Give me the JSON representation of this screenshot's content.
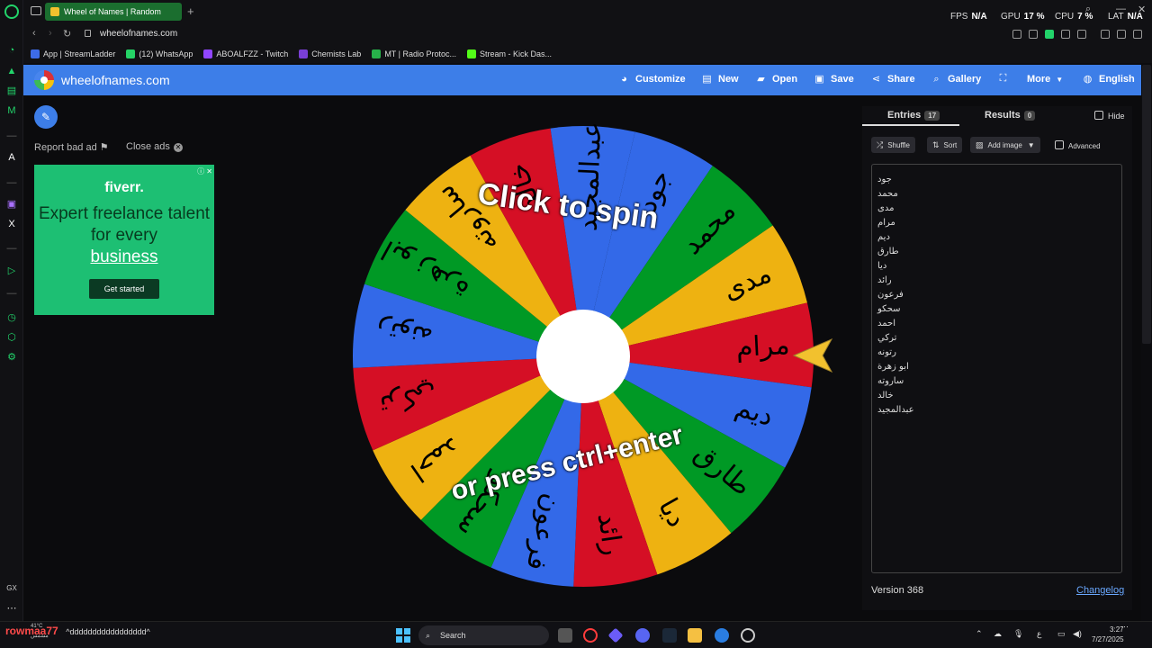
{
  "browser": {
    "tab_title": "Wheel of Names | Random",
    "url": "wheelofnames.com",
    "hud": {
      "fps_label": "FPS",
      "fps_value": "N/A",
      "gpu_label": "GPU",
      "gpu_value": "17 %",
      "cpu_label": "CPU",
      "cpu_value": "7 %",
      "lat_label": "LAT",
      "lat_value": "N/A"
    },
    "bookmarks": [
      {
        "label": "App | StreamLadder",
        "color": "#3d6be8"
      },
      {
        "label": "(12) WhatsApp",
        "color": "#25d366"
      },
      {
        "label": "ABOALFZZ - Twitch",
        "color": "#9146ff"
      },
      {
        "label": "Chemists Lab",
        "color": "#7a3fd6"
      },
      {
        "label": "MT | Radio Protoc...",
        "color": "#27b24a"
      },
      {
        "label": "Stream - Kick Das...",
        "color": "#53fc18"
      }
    ]
  },
  "site": {
    "name": "wheelofnames.com",
    "menu": {
      "customize": "Customize",
      "new": "New",
      "open": "Open",
      "save": "Save",
      "share": "Share",
      "gallery": "Gallery",
      "more": "More",
      "language": "English"
    }
  },
  "ads": {
    "report": "Report bad ad",
    "close": "Close ads",
    "brand": "fiverr.",
    "headline": "Expert freelance talent for every",
    "headline_link": "business",
    "cta": "Get started"
  },
  "wheel": {
    "cta_top": "Click to spin",
    "cta_bottom": "or press ctrl+enter",
    "colors": [
      "#3369e8",
      "#009925",
      "#eeb211",
      "#d50f25"
    ]
  },
  "panel": {
    "tab_entries": "Entries",
    "entries_count": "17",
    "tab_results": "Results",
    "results_count": "0",
    "hide": "Hide",
    "shuffle": "Shuffle",
    "sort": "Sort",
    "add_image": "Add image",
    "advanced": "Advanced",
    "entries": [
      "جود",
      "محمد",
      "مدى",
      "مرام",
      "ديم",
      "طارق",
      "ديا",
      "رائد",
      "فرعون",
      "سحكو",
      "احمد",
      "تركي",
      "رتونه",
      "ابو زهرة",
      "ساروته",
      "خالد",
      "عبدالمجيد"
    ],
    "version": "Version 368",
    "changelog": "Changelog"
  },
  "taskbar": {
    "user": "rowmaa77",
    "status_text": "^ddddddddddddddddd^",
    "temp": "41°C",
    "temp_label": "مشمس",
    "search": "Search",
    "lang": "ع",
    "time": "3:27",
    "date": "7/27/2025"
  }
}
